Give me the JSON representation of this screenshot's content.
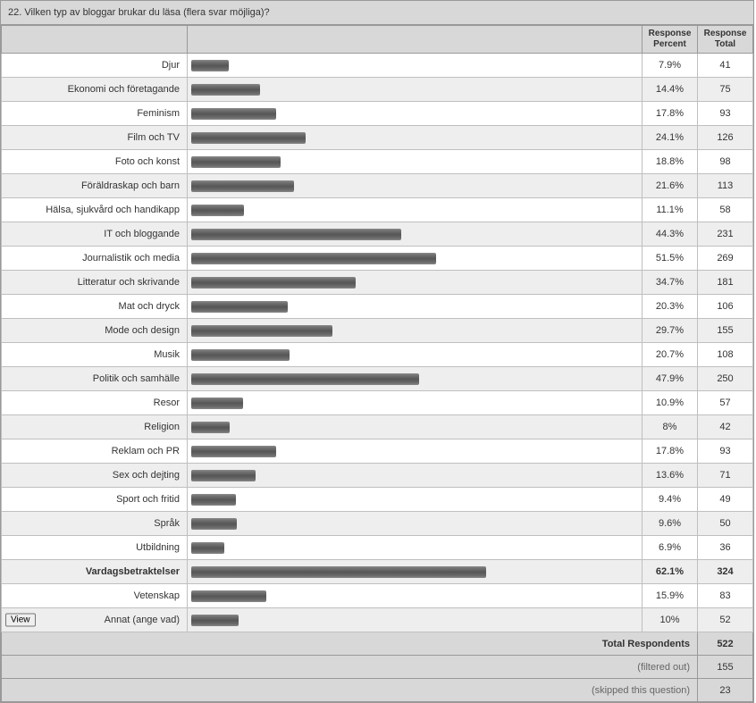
{
  "title": "22. Vilken typ av bloggar brukar du läsa (flera svar möjliga)?",
  "headers": {
    "pct_line1": "Response",
    "pct_line2": "Percent",
    "tot_line1": "Response",
    "tot_line2": "Total"
  },
  "view_button_label": "View",
  "bar_max_percent": 62.1,
  "chart_data": {
    "type": "bar",
    "title": "22. Vilken typ av bloggar brukar du läsa (flera svar möjliga)?",
    "xlabel": "Response Percent",
    "ylabel": "",
    "categories": [
      "Djur",
      "Ekonomi och företagande",
      "Feminism",
      "Film och TV",
      "Foto och konst",
      "Föräldraskap och barn",
      "Hälsa, sjukvård och handikapp",
      "IT och bloggande",
      "Journalistik och media",
      "Litteratur och skrivande",
      "Mat och dryck",
      "Mode och design",
      "Musik",
      "Politik och samhälle",
      "Resor",
      "Religion",
      "Reklam och PR",
      "Sex och dejting",
      "Sport och fritid",
      "Språk",
      "Utbildning",
      "Vardagsbetraktelser",
      "Vetenskap",
      "Annat (ange vad)"
    ],
    "series": [
      {
        "name": "Response Percent",
        "values": [
          7.9,
          14.4,
          17.8,
          24.1,
          18.8,
          21.6,
          11.1,
          44.3,
          51.5,
          34.7,
          20.3,
          29.7,
          20.7,
          47.9,
          10.9,
          8,
          17.8,
          13.6,
          9.4,
          9.6,
          6.9,
          62.1,
          15.9,
          10
        ]
      },
      {
        "name": "Response Total",
        "values": [
          41,
          75,
          93,
          126,
          98,
          113,
          58,
          231,
          269,
          181,
          106,
          155,
          108,
          250,
          57,
          42,
          93,
          71,
          49,
          50,
          36,
          324,
          83,
          52
        ]
      }
    ],
    "ylim": [
      0,
      70
    ]
  },
  "rows": [
    {
      "label": "Djur",
      "pct": "7.9%",
      "total": "41",
      "bold": false,
      "has_view": false
    },
    {
      "label": "Ekonomi och företagande",
      "pct": "14.4%",
      "total": "75",
      "bold": false,
      "has_view": false
    },
    {
      "label": "Feminism",
      "pct": "17.8%",
      "total": "93",
      "bold": false,
      "has_view": false
    },
    {
      "label": "Film och TV",
      "pct": "24.1%",
      "total": "126",
      "bold": false,
      "has_view": false
    },
    {
      "label": "Foto och konst",
      "pct": "18.8%",
      "total": "98",
      "bold": false,
      "has_view": false
    },
    {
      "label": "Föräldraskap och barn",
      "pct": "21.6%",
      "total": "113",
      "bold": false,
      "has_view": false
    },
    {
      "label": "Hälsa, sjukvård och handikapp",
      "pct": "11.1%",
      "total": "58",
      "bold": false,
      "has_view": false
    },
    {
      "label": "IT och bloggande",
      "pct": "44.3%",
      "total": "231",
      "bold": false,
      "has_view": false
    },
    {
      "label": "Journalistik och media",
      "pct": "51.5%",
      "total": "269",
      "bold": false,
      "has_view": false
    },
    {
      "label": "Litteratur och skrivande",
      "pct": "34.7%",
      "total": "181",
      "bold": false,
      "has_view": false
    },
    {
      "label": "Mat och dryck",
      "pct": "20.3%",
      "total": "106",
      "bold": false,
      "has_view": false
    },
    {
      "label": "Mode och design",
      "pct": "29.7%",
      "total": "155",
      "bold": false,
      "has_view": false
    },
    {
      "label": "Musik",
      "pct": "20.7%",
      "total": "108",
      "bold": false,
      "has_view": false
    },
    {
      "label": "Politik och samhälle",
      "pct": "47.9%",
      "total": "250",
      "bold": false,
      "has_view": false
    },
    {
      "label": "Resor",
      "pct": "10.9%",
      "total": "57",
      "bold": false,
      "has_view": false
    },
    {
      "label": "Religion",
      "pct": "8%",
      "total": "42",
      "bold": false,
      "has_view": false
    },
    {
      "label": "Reklam och PR",
      "pct": "17.8%",
      "total": "93",
      "bold": false,
      "has_view": false
    },
    {
      "label": "Sex och dejting",
      "pct": "13.6%",
      "total": "71",
      "bold": false,
      "has_view": false
    },
    {
      "label": "Sport och fritid",
      "pct": "9.4%",
      "total": "49",
      "bold": false,
      "has_view": false
    },
    {
      "label": "Språk",
      "pct": "9.6%",
      "total": "50",
      "bold": false,
      "has_view": false
    },
    {
      "label": "Utbildning",
      "pct": "6.9%",
      "total": "36",
      "bold": false,
      "has_view": false
    },
    {
      "label": "Vardagsbetraktelser",
      "pct": "62.1%",
      "total": "324",
      "bold": true,
      "has_view": false
    },
    {
      "label": "Vetenskap",
      "pct": "15.9%",
      "total": "83",
      "bold": false,
      "has_view": false
    },
    {
      "label": "Annat (ange vad)",
      "pct": "10%",
      "total": "52",
      "bold": false,
      "has_view": true
    }
  ],
  "footer": [
    {
      "label": "Total Respondents",
      "value": "522",
      "strong": true
    },
    {
      "label": "(filtered out)",
      "value": "155",
      "strong": false
    },
    {
      "label": "(skipped this question)",
      "value": "23",
      "strong": false
    }
  ]
}
